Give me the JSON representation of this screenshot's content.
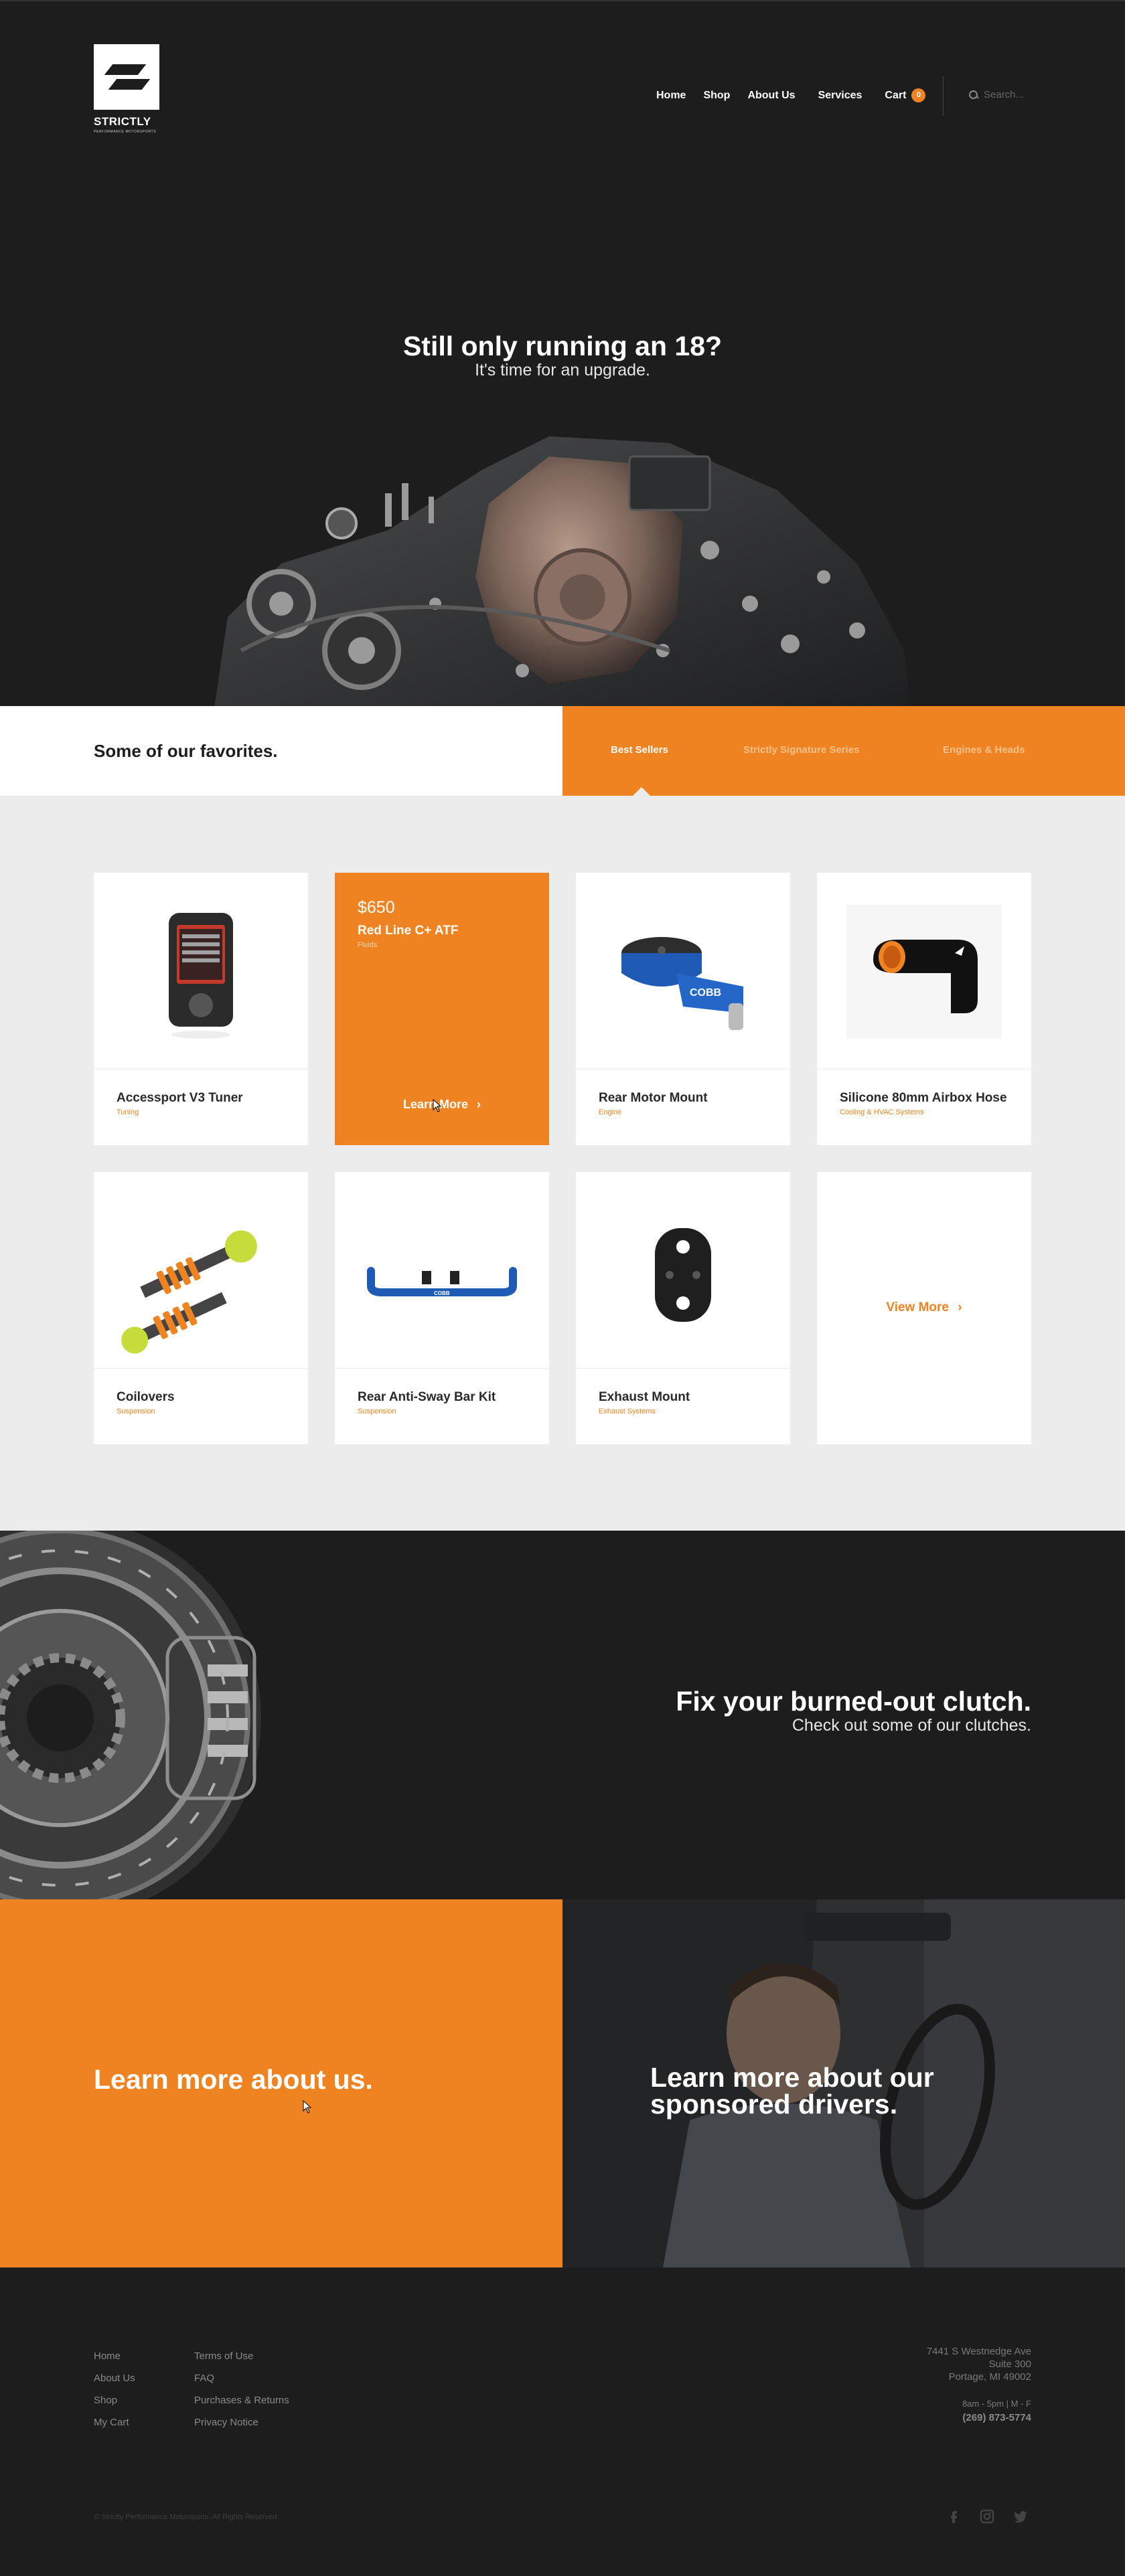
{
  "brand": {
    "name": "STRICTLY",
    "tagline": "PERFORMANCE MOTORSPORTS"
  },
  "nav": {
    "items": [
      "Home",
      "Shop",
      "About Us",
      "Services"
    ],
    "cart_label": "Cart",
    "cart_count": "0",
    "search_placeholder": "Search..."
  },
  "hero": {
    "title": "Still only running an 18?",
    "subtitle": "It's time for an upgrade."
  },
  "favorites": {
    "title": "Some of our favorites.",
    "tabs": [
      "Best Sellers",
      "Strictly Signature Series",
      "Engines & Heads"
    ],
    "active_tab": "Best Sellers"
  },
  "products": [
    {
      "name": "Accessport V3 Tuner",
      "category": "Tuning"
    },
    {
      "name": "Red Line C+ ATF",
      "category": "Fluids",
      "price": "$650",
      "cta": "Learn More"
    },
    {
      "name": "Rear Motor Mount",
      "category": "Engine"
    },
    {
      "name": "Silicone 80mm Airbox Hose",
      "category": "Cooling & HVAC Systems"
    },
    {
      "name": "Coilovers",
      "category": "Suspension"
    },
    {
      "name": "Rear Anti-Sway Bar Kit",
      "category": "Suspension"
    },
    {
      "name": "Exhaust Mount",
      "category": "Exhaust Systems"
    }
  ],
  "view_more": "View More",
  "clutch": {
    "title": "Fix your burned-out clutch.",
    "subtitle": "Check out some of our clutches."
  },
  "about_cta": "Learn more about us.",
  "drivers_cta": "Learn more about our sponsored drivers.",
  "footer": {
    "col1": [
      "Home",
      "About Us",
      "Shop",
      "My Cart"
    ],
    "col2": [
      "Terms of Use",
      "FAQ",
      "Purchases & Returns",
      "Privacy Notice"
    ],
    "address": [
      "7441 S Westnedge Ave",
      "Suite 300",
      "Portage, MI 49002"
    ],
    "hours": "8am - 5pm  |  M - F",
    "phone": "(269) 873-5774",
    "copyright": "© Strictly Performance Motorsports. All Rights Reserved.",
    "social": [
      "facebook-icon",
      "instagram-icon",
      "twitter-icon"
    ]
  },
  "colors": {
    "accent": "#ef8322",
    "dark": "#1d1d1e",
    "light": "#ececec"
  }
}
